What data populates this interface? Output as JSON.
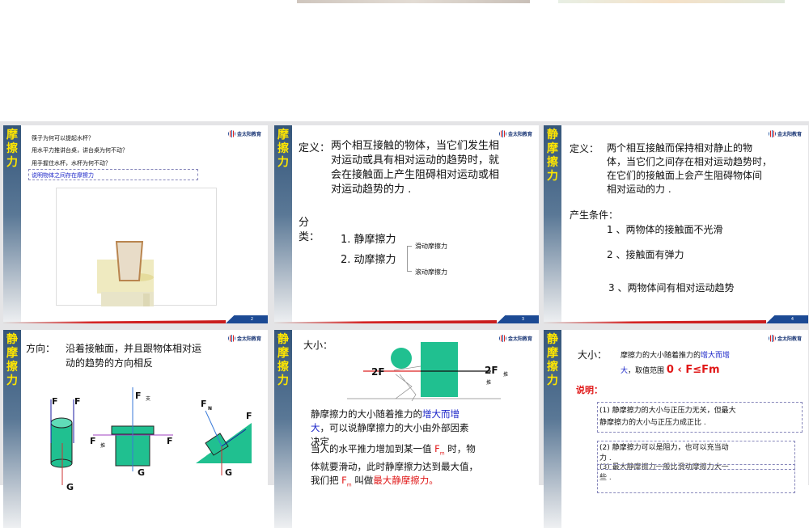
{
  "slides": [
    {
      "num": "2",
      "side": "摩擦力",
      "lines": [
        "筷子为何可以提起水杯？",
        "用水平力推讲台桌，讲台桌为何不动？",
        "用手握住水杯，水杯为何不动？"
      ],
      "box": "说明物体之间存在摩擦力"
    },
    {
      "num": "3",
      "side": "摩擦力",
      "def_label": "定义：",
      "def": [
        "两个相互接触的物体，当它们发生相",
        "对运动或具有相对运动的趋势时，就",
        "会在接触面上产生阻碍相对运动或相",
        "对运动趋势的力 ."
      ],
      "cls_label": [
        "分",
        "类："
      ],
      "items": [
        "1. 静摩擦力",
        "2. 动摩擦力"
      ],
      "sub": [
        "滑动摩擦力",
        "滚动摩擦力"
      ]
    },
    {
      "num": "4",
      "side": "静摩擦力",
      "def_label": "定义：",
      "def": [
        "两个相互接触而保持相对静止的物",
        "体，当它们之间存在相对运动趋势时，",
        "在它们的接触面上会产生阻碍物体间",
        "相对运动的力 ."
      ],
      "cond_label": "产生条件：",
      "conds": [
        "1 、两物体的接触面不光滑",
        "2 、接触面有弹力",
        "3 、两物体间有相对运动趋势"
      ]
    },
    {
      "side": "静摩擦力",
      "dir_label": "方向：",
      "dir": [
        "沿着接触面，并且跟物体相对运",
        "动的趋势的方向相反"
      ],
      "labels": {
        "f1": "F",
        "f2": "F",
        "g1": "G",
        "fz": "F",
        "zhi": "支",
        "ft": "F",
        "tui": "推",
        "f3": "F",
        "g2": "G",
        "fn": "F",
        "n": "N",
        "f4": "F",
        "g3": "G"
      }
    },
    {
      "side": "静摩擦力",
      "size_label": "大小：",
      "f_left": "2F",
      "f_right": "2F",
      "tui1": "推",
      "tui2": "推",
      "p1a": "静摩擦力的大小随着推力的",
      "p1b": "增大而增",
      "p1c": "大",
      "p1d": "，可以说静摩擦力的大小由外部因素",
      "p1e": "决定",
      "p2a": "当人的水平推力增加到某一值 ",
      "fm": "F",
      "m": "m",
      "p2b": " 时，物",
      "p2c": "体就要滑动，此时静摩擦力达到最大值，",
      "p2d": "我们把 ",
      "p2e": " 叫做",
      "p2f": "最大静摩擦力。"
    },
    {
      "side": "静摩擦力",
      "size_label": "大小：",
      "l1a": "摩擦力的大小随着推力的",
      "l1b": "增大而增",
      "l2a": "大",
      "l2b": "，取值范围",
      "range": "0 ‹ F≤Fm",
      "note": "说明：",
      "n1": [
        "(1) 静摩擦力的大小与正压力无关，但最大",
        "静摩擦力的大小与正压力成正比 ."
      ],
      "n2": [
        "(2) 静摩擦力可以是阻力，也可以充当动",
        "力 ."
      ],
      "n3": [
        "(3) 最大静摩擦力一般比滑动摩擦力大一",
        "些 ."
      ]
    }
  ],
  "logo_text": "金太阳教育"
}
